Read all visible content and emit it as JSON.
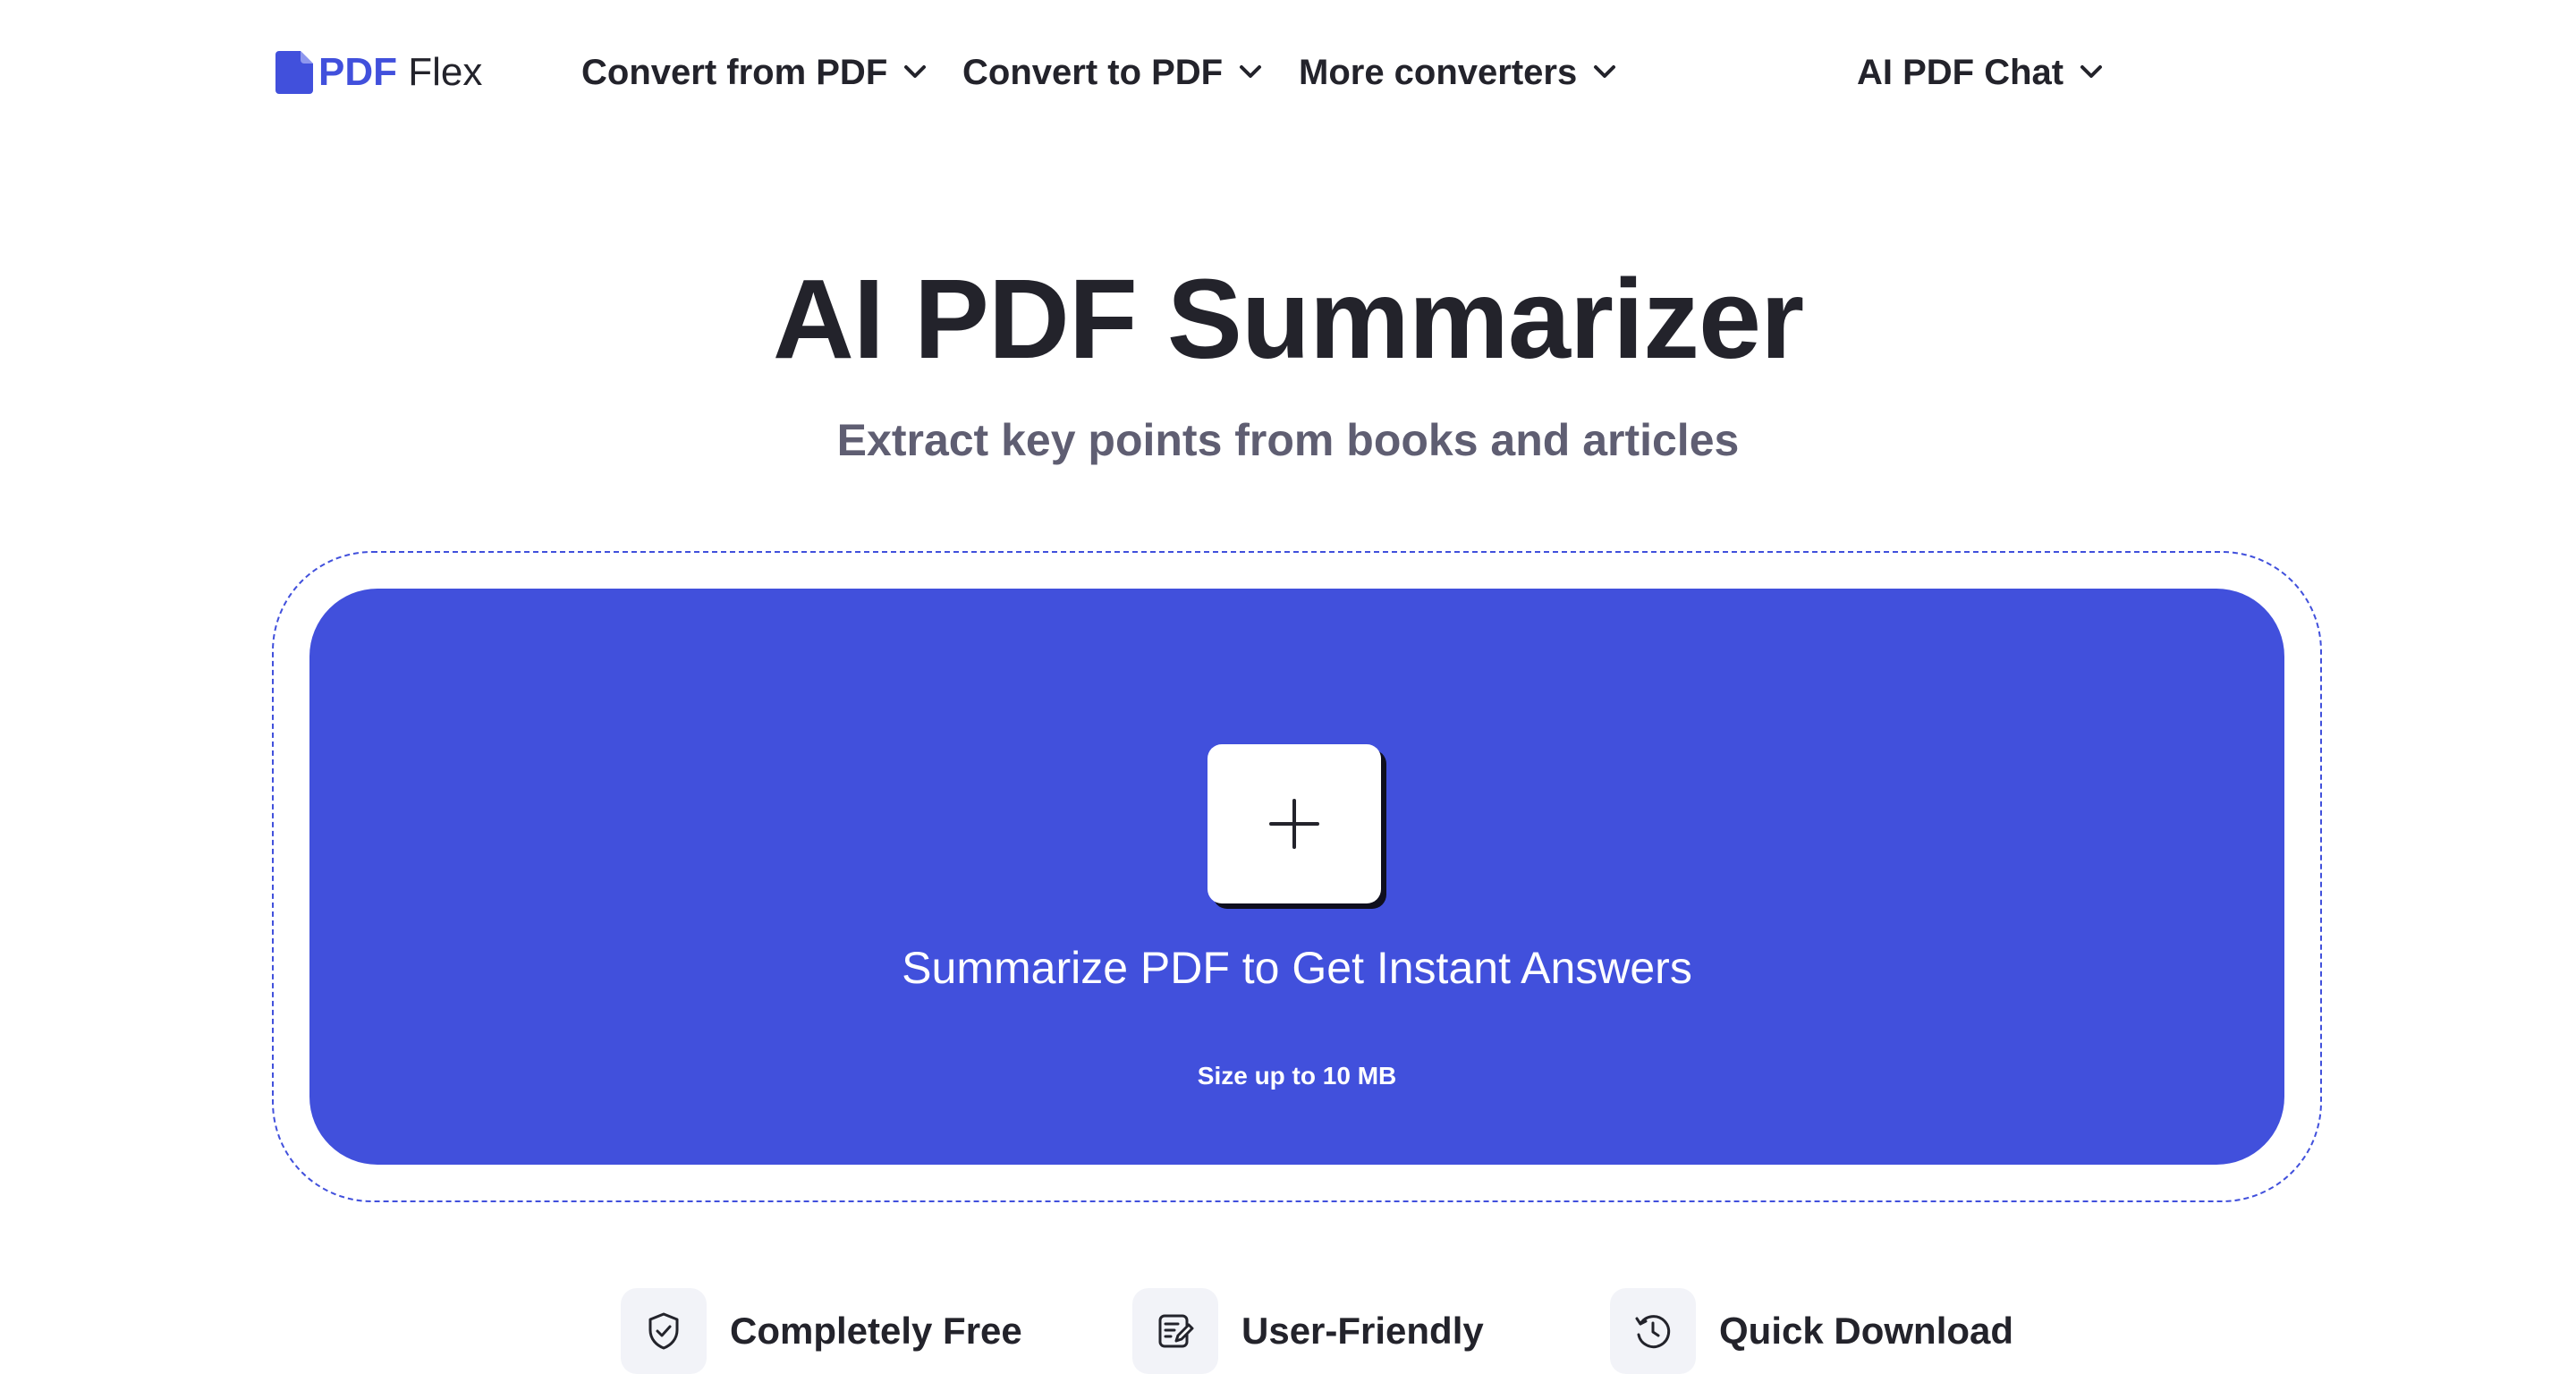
{
  "header": {
    "logo": {
      "pdf": "PDF",
      "flex": "Flex",
      "icon": "file-icon"
    },
    "nav": [
      {
        "label": "Convert from PDF",
        "icon": "chevron-down-icon"
      },
      {
        "label": "Convert to PDF",
        "icon": "chevron-down-icon"
      },
      {
        "label": "More converters",
        "icon": "chevron-down-icon"
      },
      {
        "label": "AI PDF Chat",
        "icon": "chevron-down-icon"
      }
    ]
  },
  "hero": {
    "title": "AI PDF Summarizer",
    "subtitle": "Extract key points from books and articles"
  },
  "upload": {
    "button_icon": "plus-icon",
    "label": "Summarize PDF to Get Instant Answers",
    "size_note": "Size up to 10 MB"
  },
  "features": [
    {
      "label": "Completely Free",
      "icon": "shield-check-icon"
    },
    {
      "label": "User-Friendly",
      "icon": "edit-document-icon"
    },
    {
      "label": "Quick Download",
      "icon": "clock-history-icon"
    }
  ],
  "colors": {
    "accent": "#4150dc",
    "text": "#23232b",
    "subtext": "#5f5e72",
    "icon_bg": "#f2f3f8"
  }
}
